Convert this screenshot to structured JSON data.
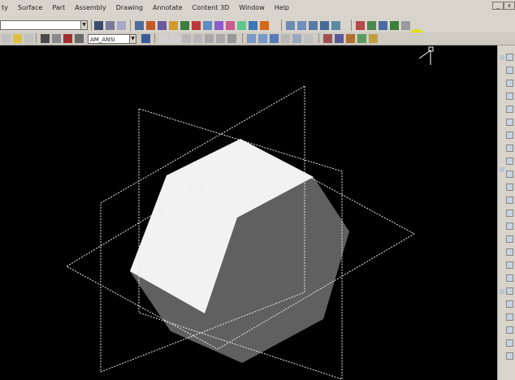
{
  "menubar": {
    "items": [
      "ty",
      "Surface",
      "Part",
      "Assembly",
      "Drawing",
      "Annotate",
      "Content 3D",
      "Window",
      "Help"
    ]
  },
  "toolbar2": {
    "layer_combo_value": "AM_ANSI"
  },
  "viewport": {
    "background": "#000000",
    "part_light_color": "#f2f2f2",
    "part_dark_color": "#606060",
    "work_plane_color": "#e8e8e8"
  },
  "icons": [
    "ucs-icon",
    "zoom-icon",
    "pan-icon",
    "orbit-icon",
    "layer-icon",
    "properties-icon",
    "save-icon",
    "open-icon"
  ]
}
